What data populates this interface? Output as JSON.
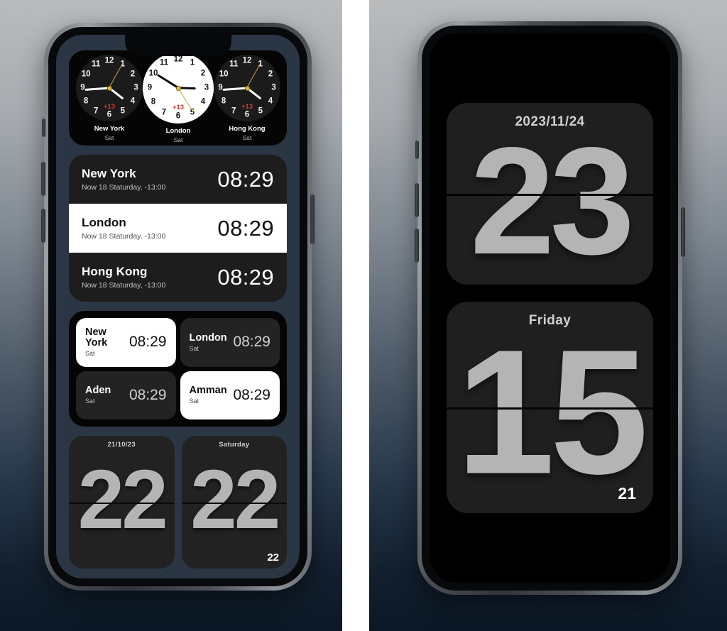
{
  "theme": {
    "bg_top": "#b9bbbd",
    "bg_bottom": "#0c1825",
    "wallpaper": "#2b3644",
    "widget_dark": "#1d1d1d",
    "widget_black": "#050505",
    "accent_offset": "#e0302c",
    "second_hand": "#c7a53b",
    "flip_digit": "#b4b4b4"
  },
  "left_phone": {
    "label": "widget-showcase-home-screen",
    "analog_widget": {
      "name": "world-clock-analog-widget",
      "numerals": [
        "12",
        "1",
        "2",
        "3",
        "4",
        "5",
        "6",
        "7",
        "8",
        "9",
        "10",
        "11"
      ],
      "clocks": [
        {
          "city": "New York",
          "day": "Sat",
          "offset": "+13",
          "style": "dark",
          "hour_deg": 128,
          "minute_deg": 266,
          "second_deg": 29
        },
        {
          "city": "London",
          "day": "Sat",
          "offset": "+13",
          "style": "light",
          "hour_deg": 92,
          "minute_deg": 302,
          "second_deg": 148
        },
        {
          "city": "Hong Kong",
          "day": "Sat",
          "offset": "+13",
          "style": "dark",
          "hour_deg": 128,
          "minute_deg": 266,
          "second_deg": 29
        }
      ]
    },
    "list_widget": {
      "name": "world-clock-list-widget",
      "rows": [
        {
          "city": "New York",
          "sub": "Now 18 Staturday, -13:00",
          "time": "08:29",
          "style": "dark"
        },
        {
          "city": "London",
          "sub": "Now 18 Staturday, -13:00",
          "time": "08:29",
          "style": "light"
        },
        {
          "city": "Hong Kong",
          "sub": "Now 18 Staturday, -13:00",
          "time": "08:29",
          "style": "dark"
        }
      ]
    },
    "grid_widget": {
      "name": "world-clock-grid-widget",
      "cells": [
        {
          "city": "New York",
          "day": "Sat",
          "time": "08:29",
          "style": "light"
        },
        {
          "city": "London",
          "day": "Sat",
          "time": "08:29",
          "style": "dark"
        },
        {
          "city": "Aden",
          "day": "Sat",
          "time": "08:29",
          "style": "dark"
        },
        {
          "city": "Amman",
          "day": "Sat",
          "time": "08:29",
          "style": "light"
        }
      ]
    },
    "flip_widgets": [
      {
        "name": "flip-clock-date-widget",
        "header": "21/10/23",
        "digits": "22",
        "corner": ""
      },
      {
        "name": "flip-clock-weekday-widget",
        "header": "Saturday",
        "digits": "22",
        "corner": "22"
      }
    ]
  },
  "right_phone": {
    "label": "flip-clock-lock-screen",
    "widgets": [
      {
        "name": "flip-clock-large-date",
        "header": "2023/11/24",
        "digits": "23",
        "corner": ""
      },
      {
        "name": "flip-clock-large-weekday",
        "header": "Friday",
        "digits": "15",
        "corner": "21"
      }
    ]
  }
}
